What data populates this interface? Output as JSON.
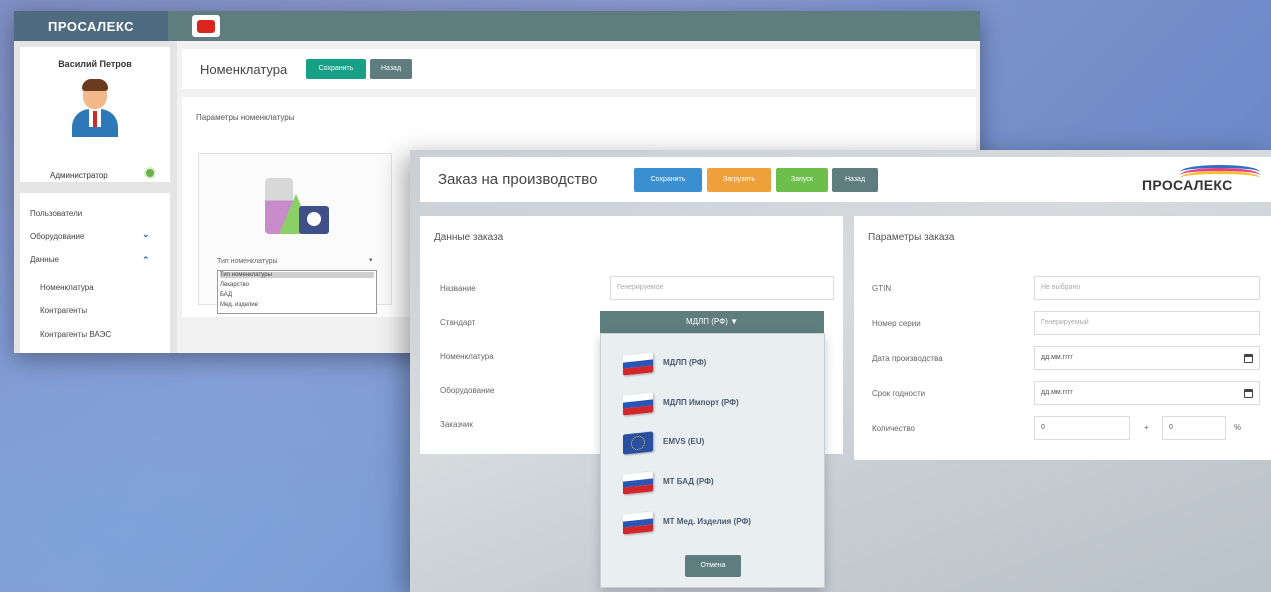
{
  "colors": {
    "teal_dark": "#5f7d7e",
    "save_green": "#17a085",
    "primary_blue": "#3a8fd0",
    "orange": "#f0a03a",
    "green": "#6cbf4a",
    "background": "#7f8fc4"
  },
  "back_window": {
    "logo": "ПРОСАЛЕКС",
    "youtube_icon": "youtube-icon",
    "user_name": "Василий Петров",
    "role": "Администратор",
    "menu": [
      {
        "label": "Пользователи"
      },
      {
        "label": "Оборудование",
        "chevron": "⌄"
      },
      {
        "label": "Данные",
        "chevron": "⌃"
      },
      {
        "label": "Номенклатура"
      },
      {
        "label": "Контрагенты"
      },
      {
        "label": "Контрагенты ВАЭС"
      }
    ],
    "title": "Номенклатура",
    "save_label": "Сохранить",
    "back_label": "Назад",
    "params_label": "Параметры номенклатуры",
    "type_label": "Тип номенклатуры",
    "type_options": [
      "Тип номенклатуры",
      "Лекарство",
      "БАД",
      "Мед. изделие"
    ]
  },
  "front_window": {
    "title": "Заказ на производство",
    "buttons": {
      "save": "Сохранить",
      "load": "Загрузить",
      "run": "Запуск",
      "back": "Назад"
    },
    "brand": "ПРОСАЛЕКС",
    "order_data": {
      "title": "Данные заказа",
      "name_label": "Название",
      "name_placeholder": "Генерируемое",
      "standard_label": "Стандарт",
      "standard_value": "МДЛП (РФ) ▼",
      "nomenclature_label": "Номенклатура",
      "equipment_label": "Оборудование",
      "customer_label": "Заказчик"
    },
    "standards": [
      {
        "label": "МДЛП (РФ)",
        "flag": "ru"
      },
      {
        "label": "МДЛП Импорт (РФ)",
        "flag": "ru"
      },
      {
        "label": "EMVS (EU)",
        "flag": "eu"
      },
      {
        "label": "МТ БАД (РФ)",
        "flag": "ru"
      },
      {
        "label": "МТ Мед. Изделия (РФ)",
        "flag": "ru"
      }
    ],
    "cancel_label": "Отмена",
    "order_params": {
      "title": "Параметры заказа",
      "gtin_label": "GTIN",
      "gtin_placeholder": "Не выбрано",
      "serial_label": "Номер серии",
      "serial_placeholder": "Генерируемый",
      "prod_date_label": "Дата производства",
      "prod_date_value": "дд.мм.гггг",
      "expiry_label": "Срок годности",
      "expiry_value": "дд.мм.гггг",
      "qty_label": "Количество",
      "qty_value": "0",
      "plus": "+",
      "pct_value": "0",
      "pct_sign": "%"
    }
  }
}
